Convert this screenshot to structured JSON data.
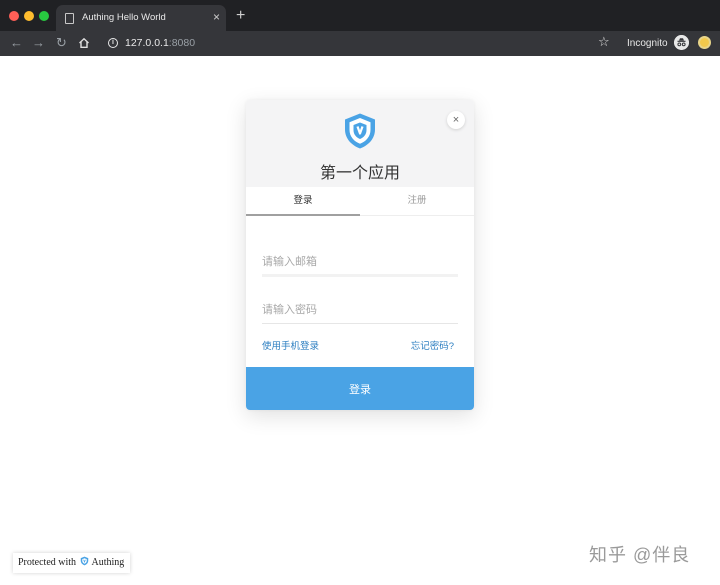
{
  "browser": {
    "tab_title": "Authing Hello World",
    "tab_close": "×",
    "new_tab": "+",
    "url_host": "127.0.0.1",
    "url_port": ":8080",
    "nav_back": "←",
    "nav_forward": "→",
    "nav_reload": "↻",
    "star": "☆",
    "incognito_label": "Incognito"
  },
  "dialog": {
    "title": "第一个应用",
    "close": "×",
    "tabs": [
      {
        "label": "登录",
        "active": true
      },
      {
        "label": "注册",
        "active": false
      }
    ],
    "email_placeholder": "请输入邮箱",
    "password_placeholder": "请输入密码",
    "phone_login_link": "使用手机登录",
    "forgot_password_link": "忘记密码?",
    "submit_label": "登录",
    "accent_color": "#4aa3e5"
  },
  "footer": {
    "protected_prefix": "Protected with",
    "protected_brand": "Authing"
  },
  "watermark": "知乎 @伴良"
}
